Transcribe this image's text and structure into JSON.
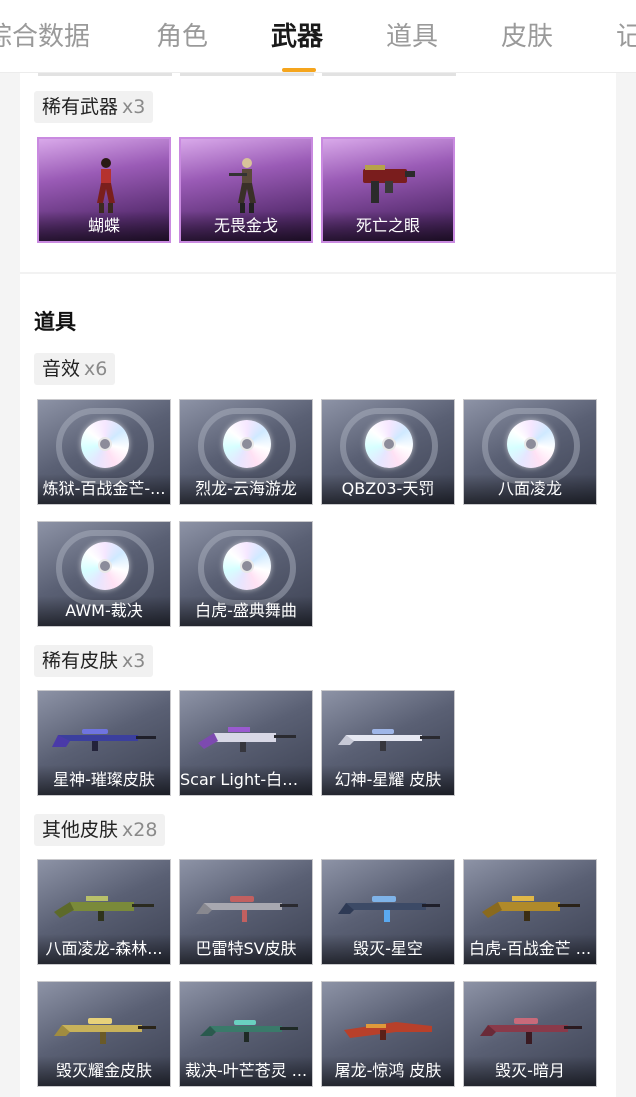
{
  "tabs": [
    {
      "label": "综合数据",
      "active": false
    },
    {
      "label": "角色",
      "active": false
    },
    {
      "label": "武器",
      "active": true
    },
    {
      "label": "道具",
      "active": false
    },
    {
      "label": "皮肤",
      "active": false
    },
    {
      "label": "记",
      "active": false
    }
  ],
  "colors": {
    "accent": "#f5a51d",
    "rare_border": "#c98ae0"
  },
  "rare_weapons": {
    "label": "稀有武器",
    "count": "x3",
    "items": [
      {
        "name": "蝴蝶",
        "icon": "character-icon"
      },
      {
        "name": "无畏金戈",
        "icon": "character-icon"
      },
      {
        "name": "死亡之眼",
        "icon": "smg-icon"
      }
    ]
  },
  "props": {
    "title": "道具",
    "sound": {
      "label": "音效",
      "count": "x6",
      "items": [
        {
          "name": "炼狱-百战金芒-..."
        },
        {
          "name": "烈龙-云海游龙"
        },
        {
          "name": "QBZ03-天罚"
        },
        {
          "name": "八面凌龙"
        },
        {
          "name": "AWM-裁决"
        },
        {
          "name": "白虎-盛典舞曲"
        }
      ]
    },
    "rare_skins": {
      "label": "稀有皮肤",
      "count": "x3",
      "items": [
        {
          "name": "星神-璀璨皮肤"
        },
        {
          "name": "Scar Light-白虎..."
        },
        {
          "name": "幻神-星耀 皮肤"
        }
      ]
    },
    "other_skins": {
      "label": "其他皮肤",
      "count": "x28",
      "items": [
        {
          "name": "八面凌龙-森林..."
        },
        {
          "name": "巴雷特SV皮肤"
        },
        {
          "name": "毁灭-星空"
        },
        {
          "name": "白虎-百战金芒 ..."
        },
        {
          "name": "毁灭耀金皮肤"
        },
        {
          "name": "裁决-叶芒苍灵 ..."
        },
        {
          "name": "屠龙-惊鸿 皮肤"
        },
        {
          "name": "毁灭-暗月"
        }
      ]
    }
  }
}
